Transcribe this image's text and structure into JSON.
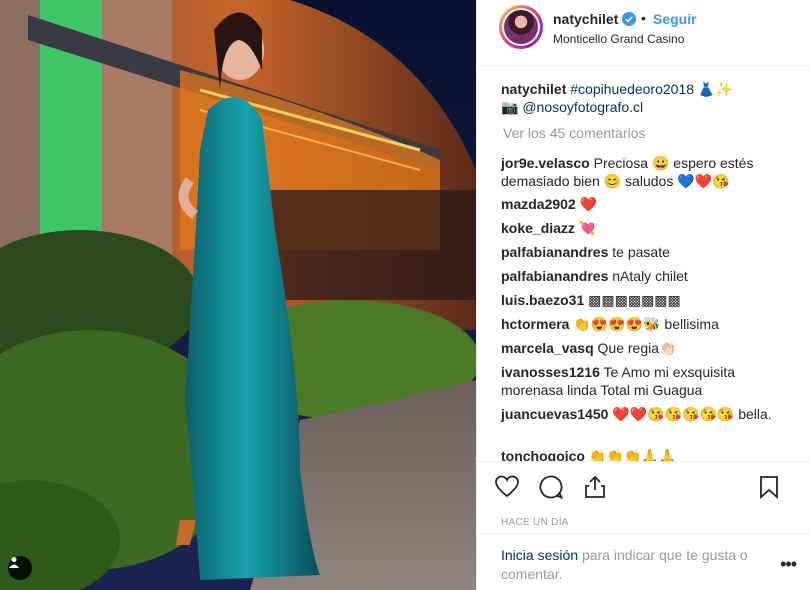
{
  "header": {
    "username": "natychilet",
    "separator": "•",
    "follow_label": "Seguir",
    "location": "Monticello Grand Casino"
  },
  "caption": {
    "username": "natychilet",
    "hashtag": "#copihuedeoro2018",
    "emoji": "👗✨",
    "camera": "📷",
    "mention": "@nosoyfotografo.cl"
  },
  "view_comments": "Ver los 45 comentarios",
  "comments": [
    {
      "user": "jor9e.velasco",
      "text": "Preciosa 😀 espero estés demasiado bien 😊 saludos 💙❤️😘"
    },
    {
      "user": "mazda2902",
      "text": "❤️"
    },
    {
      "user": "koke_diazz",
      "text": "💘"
    },
    {
      "user": "palfabianandres",
      "text": "te pasate"
    },
    {
      "user": "palfabianandres",
      "text": "nAtaly chilet"
    },
    {
      "user": "luis.baezo31",
      "text": "▩▩▩▩▩▩▩"
    },
    {
      "user": "hctormera",
      "text": "👏😍😍😍🐝 bellisima"
    },
    {
      "user": "marcela_vasq",
      "text": "Que regia👏🏻"
    },
    {
      "user": "ivanosses1216",
      "text": "Te Amo mi exsquisita morenasa linda Total mi Guagua"
    },
    {
      "user": "juancuevas1450",
      "text": "❤️❤️😘😘😘😘😘 bella."
    },
    {
      "user": "tonchogoico",
      "text": "👏👏👏🙏🙏"
    }
  ],
  "timestamp": "HACE UN DÍA",
  "login": {
    "link": "Inicia sesión",
    "rest": "para indicar que te gusta o comentar."
  },
  "icons": [
    "heart-icon",
    "comment-icon",
    "share-icon",
    "bookmark-icon",
    "user-tag-icon",
    "verified-badge-icon",
    "more-options-icon"
  ],
  "colors": {
    "accent": "#3897f0",
    "link": "#003569",
    "muted": "#999999"
  }
}
